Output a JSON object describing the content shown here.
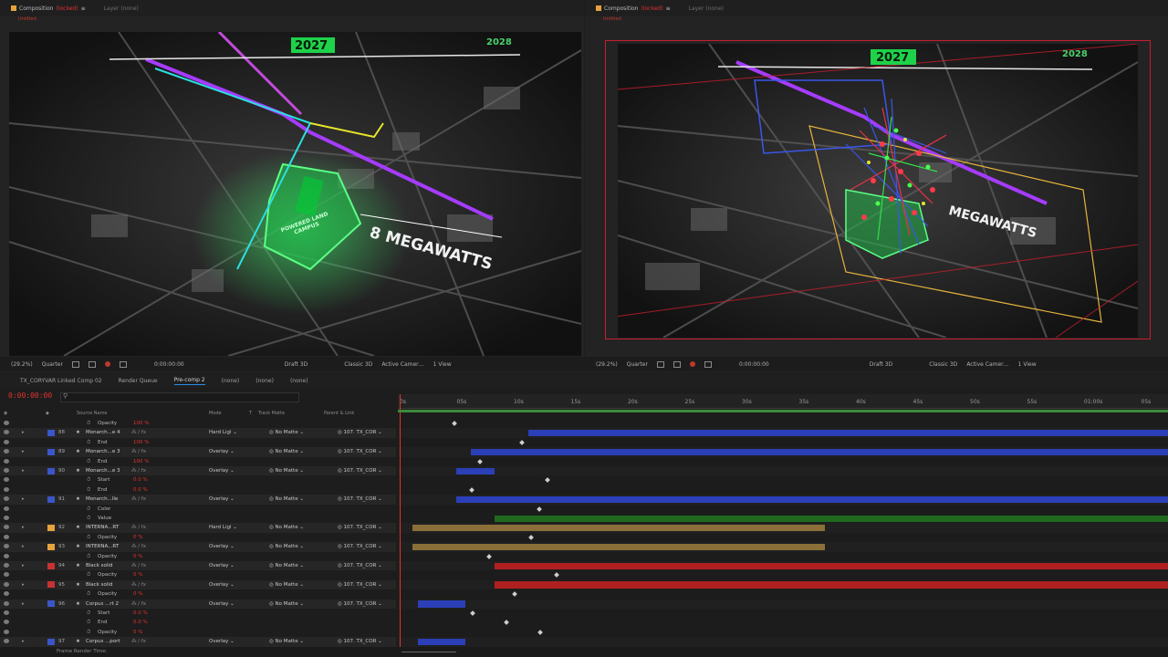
{
  "viewer_left": {
    "tabs": [
      {
        "label": "Composition",
        "suffix": "(locked)",
        "active": true
      },
      {
        "label": "Layer (none)",
        "active": false
      }
    ],
    "subtab": "Untitled",
    "overlay": {
      "year_main": "2027",
      "year_side": "2028",
      "headline": "8 MEGAWATTS",
      "campus": "POWERED LAND CAMPUS"
    },
    "toolbar": {
      "zoom": "(29.2%)",
      "resolution": "Quarter",
      "timecode": "0:00:00:00",
      "renderer": "Draft 3D",
      "engine": "Classic 3D",
      "camera": "Active Camer…",
      "views": "1 View"
    }
  },
  "viewer_right": {
    "tabs": [
      {
        "label": "Composition",
        "suffix": "(locked)",
        "active": true
      },
      {
        "label": "Layer (none)",
        "active": false
      }
    ],
    "subtab": "Untitled",
    "overlay": {
      "year_main": "2027",
      "year_side": "2028",
      "headline": "MEGAWATTS"
    },
    "toolbar": {
      "zoom": "(29.2%)",
      "resolution": "Quarter",
      "timecode": "0:00:00:00",
      "renderer": "Draft 3D",
      "engine": "Classic 3D",
      "camera": "Active Camer…",
      "views": "1 View"
    }
  },
  "timeline": {
    "tabs": [
      "TX_CORYVAR Linked Comp 02",
      "Render Queue",
      "Pre-comp 2",
      "(none)",
      "(none)",
      "(none)"
    ],
    "timecode": "0:00:00:00",
    "columns": {
      "source_name": "Source Name",
      "mode": "Mode",
      "t": "T",
      "track_matte": "Track Matte",
      "parent": "Parent & Link"
    },
    "ruler": [
      "0s",
      "05s",
      "10s",
      "15s",
      "20s",
      "25s",
      "30s",
      "35s",
      "40s",
      "45s",
      "50s",
      "55s",
      "01:00s",
      "05s"
    ],
    "footer": "Frame Render Time:",
    "rows": [
      {
        "kind": "prop",
        "name": "Opacity",
        "value": "100 %"
      },
      {
        "kind": "layer",
        "num": "88",
        "name": "Monarch...e 4",
        "mode": "Hard Ligl",
        "matte": "No Matte",
        "parent": "107. TX_COR",
        "color": "#3a56c8"
      },
      {
        "kind": "prop",
        "name": "End",
        "value": "100 %"
      },
      {
        "kind": "layer",
        "num": "89",
        "name": "Monarch...e 3",
        "mode": "Overlay",
        "matte": "No Matte",
        "parent": "107. TX_COR",
        "color": "#3a56c8"
      },
      {
        "kind": "prop",
        "name": "End",
        "value": "100 %"
      },
      {
        "kind": "layer",
        "num": "90",
        "name": "Monarch...e 3",
        "mode": "Overlay",
        "matte": "No Matte",
        "parent": "107. TX_COR",
        "color": "#3a56c8"
      },
      {
        "kind": "prop",
        "name": "Start",
        "value": "0.0 %"
      },
      {
        "kind": "prop",
        "name": "End",
        "value": "0.0 %"
      },
      {
        "kind": "layer",
        "num": "91",
        "name": "Monarch...lle",
        "mode": "Overlay",
        "matte": "No Matte",
        "parent": "107. TX_COR",
        "color": "#3a56c8"
      },
      {
        "kind": "prop",
        "name": "Color",
        "value": ""
      },
      {
        "kind": "prop",
        "name": "Value",
        "value": ""
      },
      {
        "kind": "layer",
        "num": "92",
        "name": "INTERNA...RT",
        "mode": "Hard Ligl",
        "matte": "No Matte",
        "parent": "107. TX_COR",
        "color": "#e6a23c"
      },
      {
        "kind": "prop",
        "name": "Opacity",
        "value": "0 %"
      },
      {
        "kind": "layer",
        "num": "93",
        "name": "INTERNA...RT",
        "mode": "Overlay",
        "matte": "No Matte",
        "parent": "107. TX_COR",
        "color": "#e6a23c"
      },
      {
        "kind": "prop",
        "name": "Opacity",
        "value": "0 %"
      },
      {
        "kind": "layer",
        "num": "94",
        "name": "Black solid",
        "mode": "Overlay",
        "matte": "No Matte",
        "parent": "107. TX_COR",
        "color": "#c83232"
      },
      {
        "kind": "prop",
        "name": "Opacity",
        "value": "0 %"
      },
      {
        "kind": "layer",
        "num": "95",
        "name": "Black solid",
        "mode": "Overlay",
        "matte": "No Matte",
        "parent": "107. TX_COR",
        "color": "#c83232"
      },
      {
        "kind": "prop",
        "name": "Opacity",
        "value": "0 %"
      },
      {
        "kind": "layer",
        "num": "96",
        "name": "Corpus ...rt 2",
        "mode": "Overlay",
        "matte": "No Matte",
        "parent": "107. TX_COR",
        "color": "#3a56c8"
      },
      {
        "kind": "prop",
        "name": "Start",
        "value": "0.0 %"
      },
      {
        "kind": "prop",
        "name": "End",
        "value": "0.0 %"
      },
      {
        "kind": "prop",
        "name": "Opacity",
        "value": "0 %"
      },
      {
        "kind": "layer",
        "num": "97",
        "name": "Corpus ...port",
        "mode": "Overlay",
        "matte": "No Matte",
        "parent": "107. TX_COR",
        "color": "#3a56c8"
      }
    ]
  },
  "colors": {
    "bar_blue": "#2b3fb8",
    "bar_tan": "#8a7038",
    "bar_red": "#b02020",
    "bar_green": "#1f6a1f",
    "accent_red": "#e2332f",
    "accent_blue": "#2d8ceb"
  }
}
